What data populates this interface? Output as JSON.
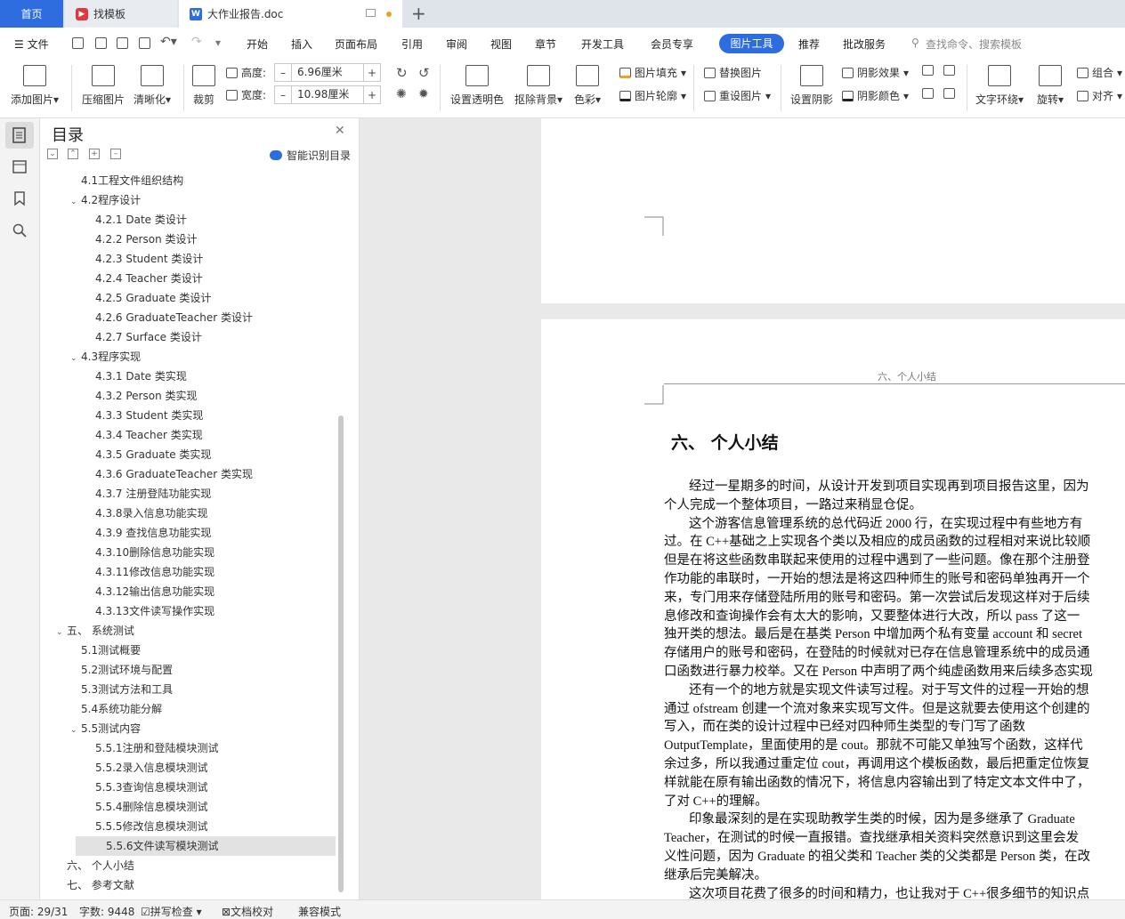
{
  "tabs": {
    "home": "首页",
    "find": "找模板",
    "doc": "大作业报告.doc"
  },
  "menu": [
    "文件",
    "开始",
    "插入",
    "页面布局",
    "引用",
    "审阅",
    "视图",
    "章节",
    "开发工具",
    "会员专享",
    "图片工具",
    "推荐",
    "批改服务"
  ],
  "search": "查找命令、搜索模板",
  "ribbon": {
    "add_pic": "添加图片",
    "compress": "压缩图片",
    "clarify": "清晰化",
    "crop": "裁剪",
    "height_label": "高度:",
    "height_value": "6.96厘米",
    "width_label": "宽度:",
    "width_value": "10.98厘米",
    "transparent": "设置透明色",
    "remove_bg": "抠除背景",
    "color": "色彩",
    "fill": "图片填充",
    "outline": "图片轮廓",
    "replace": "替换图片",
    "reset": "重设图片",
    "shadow": "设置阴影",
    "shadow_effect": "阴影效果",
    "shadow_color": "阴影颜色",
    "wrap": "文字环绕",
    "rotate": "旋转",
    "group": "组合",
    "align": "对齐"
  },
  "toc": {
    "title": "目录",
    "smart": "智能识别目录",
    "items": [
      {
        "text": "4.1工程文件组织结构",
        "level": 2
      },
      {
        "text": "4.2程序设计",
        "level": 2,
        "open": true
      },
      {
        "text": "4.2.1  Date 类设计",
        "level": 3
      },
      {
        "text": "4.2.2  Person 类设计",
        "level": 3
      },
      {
        "text": "4.2.3  Student 类设计",
        "level": 3
      },
      {
        "text": "4.2.4  Teacher 类设计",
        "level": 3
      },
      {
        "text": "4.2.5  Graduate 类设计",
        "level": 3
      },
      {
        "text": "4.2.6  GraduateTeacher 类设计",
        "level": 3
      },
      {
        "text": "4.2.7  Surface 类设计",
        "level": 3
      },
      {
        "text": "4.3程序实现",
        "level": 2,
        "open": true
      },
      {
        "text": "4.3.1  Date 类实现",
        "level": 3
      },
      {
        "text": "4.3.2  Person 类实现",
        "level": 3
      },
      {
        "text": "4.3.3  Student 类实现",
        "level": 3
      },
      {
        "text": "4.3.4  Teacher 类实现",
        "level": 3
      },
      {
        "text": "4.3.5  Graduate 类实现",
        "level": 3
      },
      {
        "text": "4.3.6  GraduateTeacher 类实现",
        "level": 3
      },
      {
        "text": "4.3.7  注册登陆功能实现",
        "level": 3
      },
      {
        "text": "4.3.8录入信息功能实现",
        "level": 3
      },
      {
        "text": "4.3.9  查找信息功能实现",
        "level": 3
      },
      {
        "text": "4.3.10删除信息功能实现",
        "level": 3
      },
      {
        "text": "4.3.11修改信息功能实现",
        "level": 3
      },
      {
        "text": "4.3.12输出信息功能实现",
        "level": 3
      },
      {
        "text": "4.3.13文件读写操作实现",
        "level": 3
      },
      {
        "text": "五、  系统测试",
        "level": 1,
        "open": true
      },
      {
        "text": "5.1测试概要",
        "level": 2
      },
      {
        "text": "5.2测试环境与配置",
        "level": 2
      },
      {
        "text": "5.3测试方法和工具",
        "level": 2
      },
      {
        "text": "5.4系统功能分解",
        "level": 2
      },
      {
        "text": "5.5测试内容",
        "level": 2,
        "open": true
      },
      {
        "text": "5.5.1注册和登陆模块测试",
        "level": 3
      },
      {
        "text": "5.5.2录入信息模块测试",
        "level": 3
      },
      {
        "text": "5.5.3查询信息模块测试",
        "level": 3
      },
      {
        "text": "5.5.4删除信息模块测试",
        "level": 3
      },
      {
        "text": "5.5.5修改信息模块测试",
        "level": 3
      },
      {
        "text": "5.5.6文件读写模块测试",
        "level": 3,
        "selected": true
      },
      {
        "text": "六、 个人小结",
        "level": 1
      },
      {
        "text": "七、 参考文献",
        "level": 1
      }
    ]
  },
  "doc": {
    "header": "六、个人小结",
    "heading": "六、  个人小结",
    "lines": [
      {
        "t": "经过一星期多的时间，从设计开发到项目实现再到项目报告这里，因为",
        "i": true
      },
      {
        "t": "个人完成一个整体项目，一路过来稍显仓促。",
        "i": false
      },
      {
        "t": "这个游客信息管理系统的总代码近 2000 行，在实现过程中有些地方有",
        "i": true
      },
      {
        "t": "过。在 C++基础之上实现各个类以及相应的成员函数的过程相对来说比较顺",
        "i": false
      },
      {
        "t": "但是在将这些函数串联起来使用的过程中遇到了一些问题。像在那个注册登",
        "i": false
      },
      {
        "t": "作功能的串联时，一开始的想法是将这四种师生的账号和密码单独再开一个",
        "i": false
      },
      {
        "t": "来，专门用来存储登陆所用的账号和密码。第一次尝试后发现这样对于后续",
        "i": false
      },
      {
        "t": "息修改和查询操作会有太大的影响，又要整体进行大改，所以 pass 了这一",
        "i": false
      },
      {
        "t": "独开类的想法。最后是在基类 Person 中增加两个私有变量 account 和 secret",
        "i": false
      },
      {
        "t": "存储用户的账号和密码，在登陆的时候就对已存在信息管理系统中的成员通",
        "i": false
      },
      {
        "t": "口函数进行暴力校举。又在 Person 中声明了两个纯虚函数用来后续多态实现",
        "i": false
      },
      {
        "t": "还有一个的地方就是实现文件读写过程。对于写文件的过程一开始的想",
        "i": true
      },
      {
        "t": "通过 ofstream 创建一个流对象来实现写文件。但是这就要去使用这个创建的",
        "i": false
      },
      {
        "t": "写入，而在类的设计过程中已经对四种师生类型的专门写了函数",
        "i": false
      },
      {
        "t": "OutputTemplate，里面使用的是 cout。那就不可能又单独写个函数，这样代",
        "i": false
      },
      {
        "t": "余过多，所以我通过重定位 cout，再调用这个模板函数，最后把重定位恢复",
        "i": false
      },
      {
        "t": "样就能在原有输出函数的情况下，将信息内容输出到了特定文本文件中了，",
        "i": false
      },
      {
        "t": "了对 C++的理解。",
        "i": false
      },
      {
        "t": "印象最深刻的是在实现助教学生类的时候，因为是多继承了 Graduate",
        "i": true
      },
      {
        "t": "Teacher，在测试的时候一直报错。查找继承相关资料突然意识到这里会发",
        "i": false
      },
      {
        "t": "义性问题，因为 Graduate 的祖父类和 Teacher 类的父类都是 Person 类，在改",
        "i": false
      },
      {
        "t": "继承后完美解决。",
        "i": false
      },
      {
        "t": "这次项目花费了很多的时间和精力，也让我对于 C++很多细节的知识点",
        "i": true
      }
    ]
  },
  "status": {
    "page": "页面: 29/31",
    "words": "字数: 9448",
    "spell": "拼写检查",
    "proof": "文档校对",
    "compat": "兼容模式"
  }
}
